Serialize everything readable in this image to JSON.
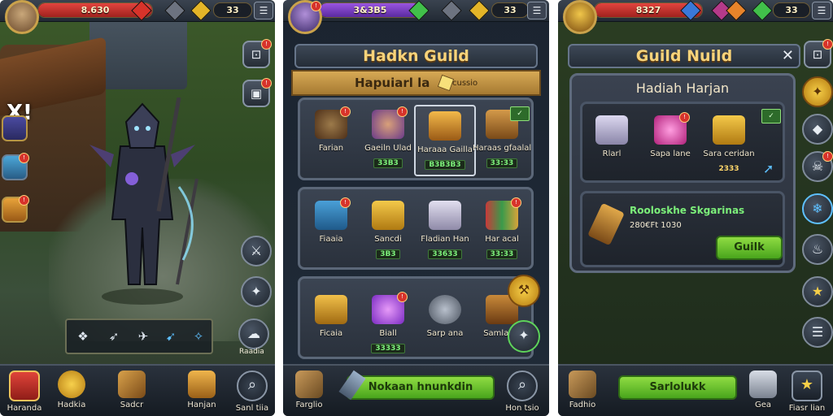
{
  "screen1": {
    "top": {
      "resource_value": "8.630",
      "right_value": "33"
    },
    "hint_text": "X!",
    "nav": [
      {
        "label": "Haranda",
        "icon": "red-crate-icon"
      },
      {
        "label": "Hadkia",
        "icon": "gold-coin-icon"
      },
      {
        "label": "Sadcr",
        "icon": "boxes-icon"
      },
      {
        "label": "Hanjan",
        "icon": "chest-icon"
      },
      {
        "label": "Sanl tiia",
        "icon": "search-icon"
      }
    ],
    "side_button_label": "Raadia"
  },
  "screen2": {
    "top": {
      "resource_value": "3&3B5",
      "right_value": "33"
    },
    "title": "Hadkn Guild",
    "banner_title": "Hapuiarl la",
    "banner_sub": "cussio",
    "rows": [
      [
        {
          "name": "Farian",
          "price": null,
          "icon": "armor-icon"
        },
        {
          "name": "Gaeiln Ulad",
          "price": "33B3",
          "icon": "hero-portrait-icon"
        },
        {
          "name": "Haraaa Gailla",
          "price": "B3B3B3",
          "icon": "treasure-icon",
          "selected": true
        },
        {
          "name": "Haraas gfaalal",
          "price": "33:33",
          "icon": "crate-icon"
        }
      ],
      [
        {
          "name": "Fiaaia",
          "price": null,
          "icon": "chest-blue-icon"
        },
        {
          "name": "Sancdi",
          "price": "3B3",
          "icon": "gold-bars-icon"
        },
        {
          "name": "Fladian Han",
          "price": "33633",
          "icon": "silver-chest-icon"
        },
        {
          "name": "Har acal",
          "price": "33:33",
          "icon": "books-icon"
        }
      ],
      [
        {
          "name": "Ficaia",
          "price": null,
          "icon": "gold-ore-icon"
        },
        {
          "name": "Biall",
          "price": "33333",
          "icon": "purple-gem-icon"
        },
        {
          "name": "Sarp ana",
          "price": null,
          "icon": "mace-icon"
        },
        {
          "name": "Samlaiall",
          "price": null,
          "icon": "wooden-crate-icon"
        }
      ]
    ],
    "button_label": "Nokaan hnunkdin",
    "nav_left_label": "Farglio",
    "nav_right_label": "Hon tsio"
  },
  "screen3": {
    "top": {
      "resource_value": "8327",
      "right_value": "33"
    },
    "title": "Guild Nuild",
    "close": "✕",
    "modal_title": "Hadiah Harjan",
    "items": [
      {
        "name": "Rlarl",
        "price": null,
        "icon": "silver-crate-icon"
      },
      {
        "name": "Sapa lane",
        "price": null,
        "icon": "pink-gem-icon"
      },
      {
        "name": "Sara ceridan",
        "price": "2333",
        "icon": "gold-bars-icon"
      }
    ],
    "reward_title": "Rooloskhe Skgarinas",
    "reward_value": "280€Ft 1030",
    "claim_button": "Guilk",
    "bottom_button": "Sarlolukk",
    "nav_left_label": "Fadhio",
    "nav_mid_label": "Gea",
    "nav_right_label": "Fiasr lian"
  },
  "colors": {
    "gold": "#f7d37a",
    "green_button": "#6fc52f",
    "price_green": "#7cf07a",
    "hp_red": "#c9302c",
    "mana_purple": "#7a3bc5"
  }
}
